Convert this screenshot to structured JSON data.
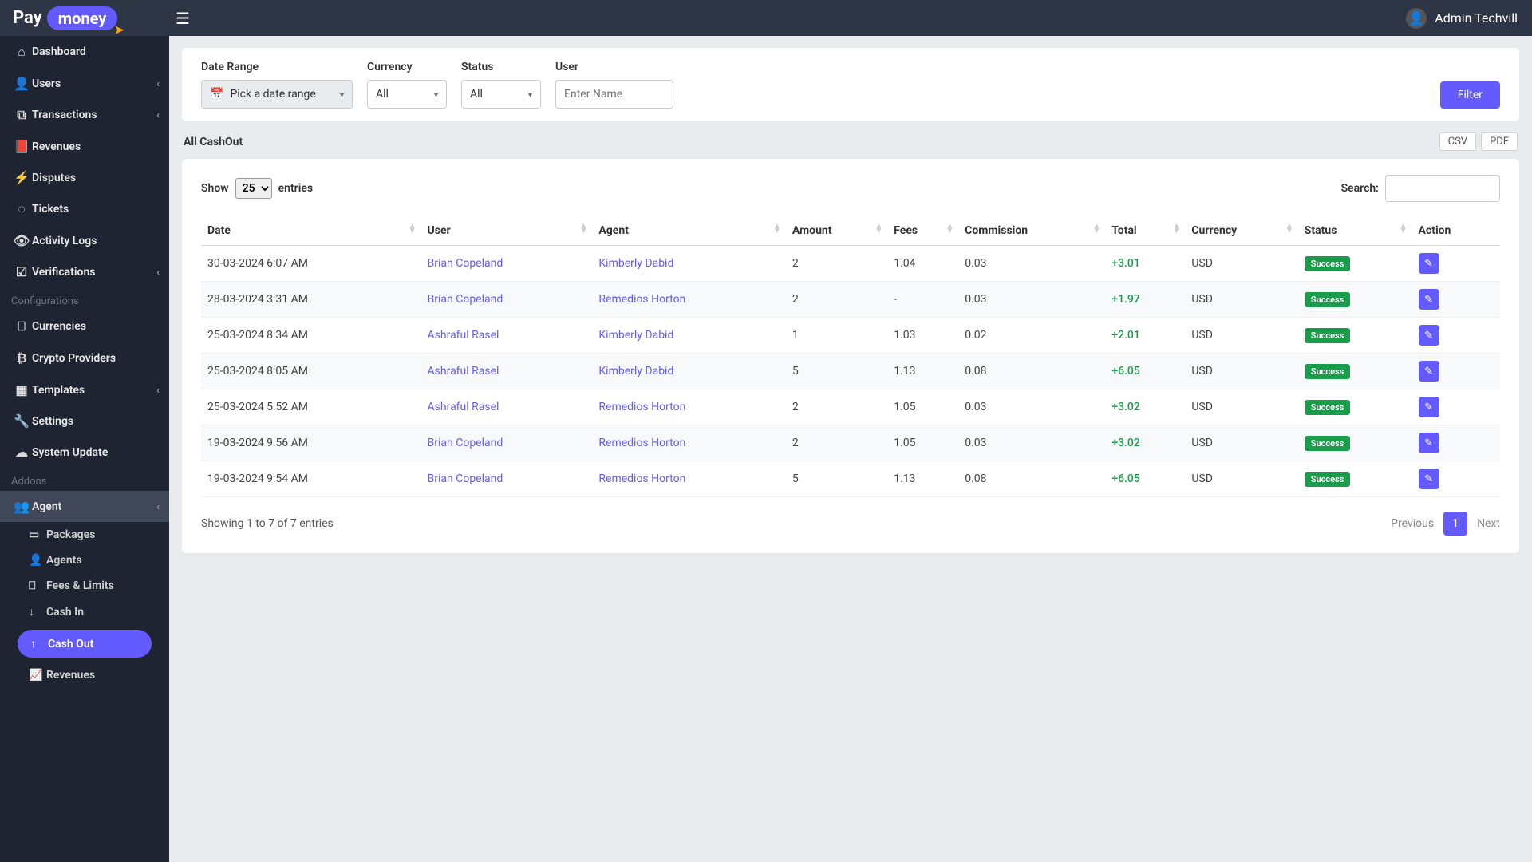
{
  "brand": {
    "pay": "Pay",
    "money": "money"
  },
  "user_name": "Admin Techvill",
  "sidebar": {
    "items": [
      {
        "label": "Dashboard",
        "icon": "⌂"
      },
      {
        "label": "Users",
        "icon": "👤",
        "chev": true
      },
      {
        "label": "Transactions",
        "icon": "⧉",
        "chev": true
      },
      {
        "label": "Revenues",
        "icon": "📕"
      },
      {
        "label": "Disputes",
        "icon": "⚡"
      },
      {
        "label": "Tickets",
        "icon": "◌"
      },
      {
        "label": "Activity Logs",
        "icon": "👁"
      },
      {
        "label": "Verifications",
        "icon": "☑",
        "chev": true
      }
    ],
    "config_label": "Configurations",
    "config": [
      {
        "label": "Currencies",
        "icon": "⎕"
      },
      {
        "label": "Crypto Providers",
        "icon": "₿"
      },
      {
        "label": "Templates",
        "icon": "▦",
        "chev": true
      },
      {
        "label": "Settings",
        "icon": "🔧"
      },
      {
        "label": "System Update",
        "icon": "☁"
      }
    ],
    "addons_label": "Addons",
    "agent_label": "Agent",
    "agent_icon": "👥",
    "agent_sub": [
      {
        "label": "Packages",
        "icon": "▭"
      },
      {
        "label": "Agents",
        "icon": "👤"
      },
      {
        "label": "Fees & Limits",
        "icon": "⎕"
      },
      {
        "label": "Cash In",
        "icon": "↓"
      },
      {
        "label": "Cash Out",
        "icon": "↑",
        "active": true
      },
      {
        "label": "Revenues",
        "icon": "📈"
      }
    ]
  },
  "filters": {
    "date_label": "Date Range",
    "date_placeholder": "Pick a date range",
    "currency_label": "Currency",
    "currency_value": "All",
    "status_label": "Status",
    "status_value": "All",
    "user_label": "User",
    "user_placeholder": "Enter Name",
    "filter_btn": "Filter"
  },
  "page_title": "All CashOut",
  "export": {
    "csv": "CSV",
    "pdf": "PDF"
  },
  "show_label": "Show",
  "entries_label": "entries",
  "entries_value": "25",
  "search_label": "Search:",
  "columns": [
    "Date",
    "User",
    "Agent",
    "Amount",
    "Fees",
    "Commission",
    "Total",
    "Currency",
    "Status",
    "Action"
  ],
  "rows": [
    {
      "date": "30-03-2024 6:07 AM",
      "user": "Brian Copeland",
      "agent": "Kimberly Dabid",
      "amount": "2",
      "fees": "1.04",
      "commission": "0.03",
      "total": "+3.01",
      "currency": "USD",
      "status": "Success"
    },
    {
      "date": "28-03-2024 3:31 AM",
      "user": "Brian Copeland",
      "agent": "Remedios Horton",
      "amount": "2",
      "fees": "-",
      "commission": "0.03",
      "total": "+1.97",
      "currency": "USD",
      "status": "Success"
    },
    {
      "date": "25-03-2024 8:34 AM",
      "user": "Ashraful Rasel",
      "agent": "Kimberly Dabid",
      "amount": "1",
      "fees": "1.03",
      "commission": "0.02",
      "total": "+2.01",
      "currency": "USD",
      "status": "Success"
    },
    {
      "date": "25-03-2024 8:05 AM",
      "user": "Ashraful Rasel",
      "agent": "Kimberly Dabid",
      "amount": "5",
      "fees": "1.13",
      "commission": "0.08",
      "total": "+6.05",
      "currency": "USD",
      "status": "Success"
    },
    {
      "date": "25-03-2024 5:52 AM",
      "user": "Ashraful Rasel",
      "agent": "Remedios Horton",
      "amount": "2",
      "fees": "1.05",
      "commission": "0.03",
      "total": "+3.02",
      "currency": "USD",
      "status": "Success"
    },
    {
      "date": "19-03-2024 9:56 AM",
      "user": "Brian Copeland",
      "agent": "Remedios Horton",
      "amount": "2",
      "fees": "1.05",
      "commission": "0.03",
      "total": "+3.02",
      "currency": "USD",
      "status": "Success"
    },
    {
      "date": "19-03-2024 9:54 AM",
      "user": "Brian Copeland",
      "agent": "Remedios Horton",
      "amount": "5",
      "fees": "1.13",
      "commission": "0.08",
      "total": "+6.05",
      "currency": "USD",
      "status": "Success"
    }
  ],
  "info_text": "Showing 1 to 7 of 7 entries",
  "pagination": {
    "prev": "Previous",
    "page": "1",
    "next": "Next"
  }
}
